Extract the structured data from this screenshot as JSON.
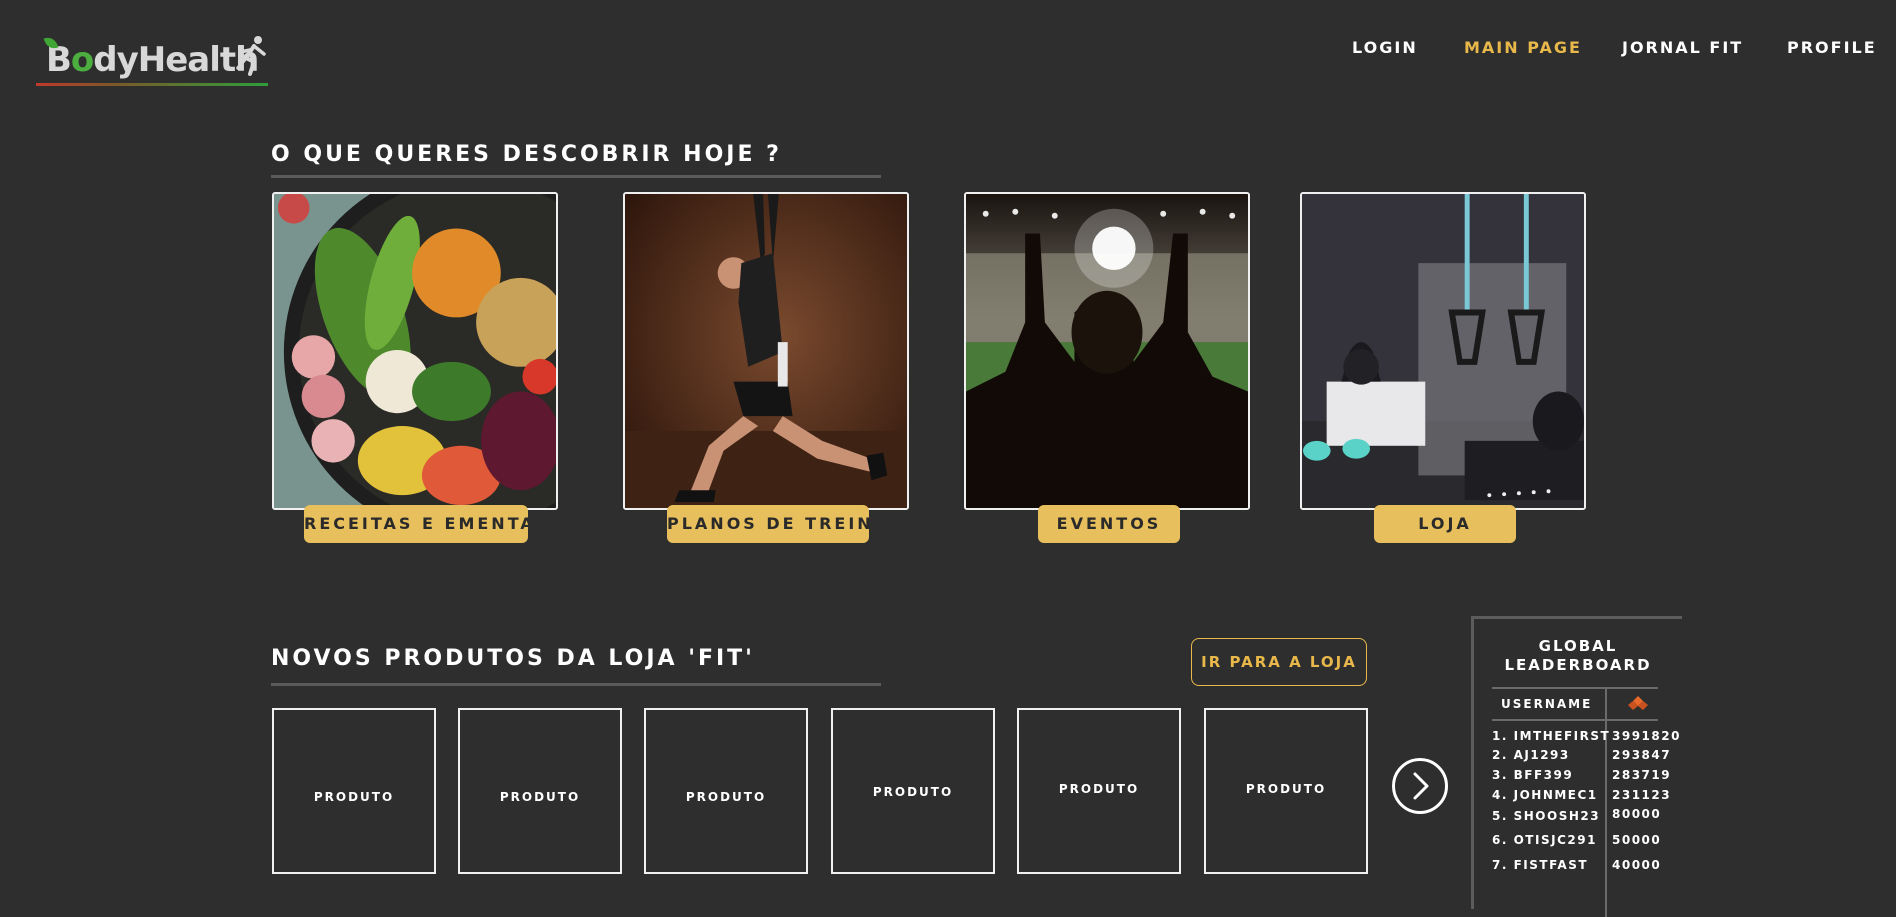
{
  "brand": {
    "logo_text_prefix": "B",
    "logo_text_o": "o",
    "logo_text_suffix": "dyHealth"
  },
  "nav": {
    "items": [
      {
        "label": "LOGIN",
        "active": false
      },
      {
        "label": "MAIN PAGE",
        "active": true
      },
      {
        "label": "JORNAL FIT",
        "active": false
      },
      {
        "label": "PROFILE",
        "active": false
      }
    ]
  },
  "discover": {
    "title": "O QUE QUERES DESCOBRIR HOJE ?",
    "cards": [
      {
        "label": "RECEITAS E EMENTAS",
        "image": "food-bowl"
      },
      {
        "label": "PLANOS DE TREINO",
        "image": "athlete-lunge"
      },
      {
        "label": "EVENTOS",
        "image": "stadium-fan"
      },
      {
        "label": "LOJA",
        "image": "gym-equipment"
      }
    ]
  },
  "store": {
    "title": "NOVOS PRODUTOS DA LOJA 'FIT'",
    "go_to_store_label": "IR PARA A LOJA",
    "products": [
      {
        "label": "PRODUTO"
      },
      {
        "label": "PRODUTO"
      },
      {
        "label": "PRODUTO"
      },
      {
        "label": "PRODUTO"
      },
      {
        "label": "PRODUTO"
      },
      {
        "label": "PRODUTO"
      }
    ],
    "next_icon": "chevron-right-icon"
  },
  "leaderboard": {
    "title_line1": "GLOBAL",
    "title_line2": "LEADERBOARD",
    "col_username": "USERNAME",
    "col_score_icon": "diamond-icon",
    "accent_color": "#e8692a",
    "rows": [
      {
        "rank": "1.",
        "user": "IMTHEFIRST",
        "score": "3991820"
      },
      {
        "rank": "2.",
        "user": "AJ1293",
        "score": "293847"
      },
      {
        "rank": "3.",
        "user": "BFF399",
        "score": "283719"
      },
      {
        "rank": "4.",
        "user": "JOHNMEC1",
        "score": "231123"
      },
      {
        "rank": "5.",
        "user": "SHOOSH23",
        "score": "80000"
      },
      {
        "rank": "6.",
        "user": "OTISJC291",
        "score": "50000"
      },
      {
        "rank": "7.",
        "user": "FISTFAST",
        "score": "40000"
      }
    ]
  },
  "colors": {
    "background": "#2e2e2e",
    "accent_gold": "#e8b84b",
    "button_gold": "#e8bf5d"
  }
}
